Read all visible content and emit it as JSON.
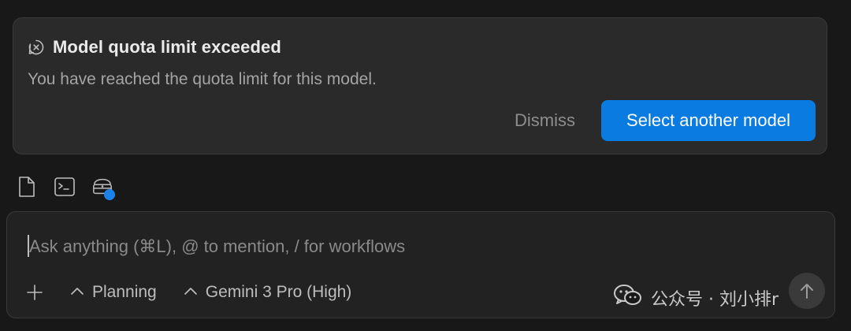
{
  "alert": {
    "title": "Model quota limit exceeded",
    "message": "You have reached the quota limit for this model.",
    "dismiss_label": "Dismiss",
    "select_label": "Select another model",
    "icon": "error-circle-icon"
  },
  "context_icons": [
    {
      "name": "file-icon"
    },
    {
      "name": "terminal-icon"
    },
    {
      "name": "browser-stack-icon",
      "badge": true
    }
  ],
  "input": {
    "placeholder": "Ask anything (⌘L), @ to mention, / for workflows",
    "value": ""
  },
  "toolbar": {
    "mode_label": "Planning",
    "model_label": "Gemini 3 Pro (High)"
  },
  "watermark": {
    "text": "公众号 · 刘小排r"
  },
  "colors": {
    "background": "#181818",
    "card": "#2a2a2a",
    "accent": "#0a7be0",
    "muted_text": "#a4a4a4"
  }
}
